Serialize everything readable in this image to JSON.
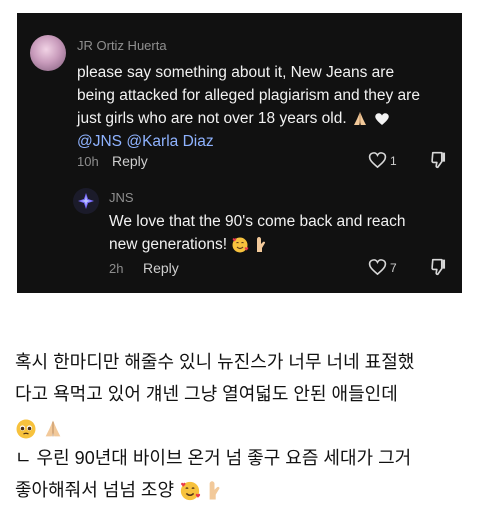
{
  "comment": {
    "username": "JR Ortiz Huerta",
    "line1": "please say something about it, New Jeans are",
    "line2": "being attacked for alleged plagiarism and they are",
    "line3": "just girls who are not over 18 years old.",
    "mention1": "@JNS",
    "mention2": "@Karla Diaz",
    "time": "10h",
    "reply_label": "Reply",
    "likes": "1",
    "icons": [
      "prayer-hands-emoji",
      "white-heart-emoji",
      "heart-outline-icon",
      "thumbs-down-icon"
    ]
  },
  "reply": {
    "username": "JNS",
    "line1": "We love that the 90's come back and reach",
    "line2": "new generations!",
    "time": "2h",
    "reply_label": "Reply",
    "likes": "7",
    "icons": [
      "smiling-face-with-hearts-emoji",
      "crossed-fingers-emoji",
      "heart-outline-icon",
      "thumbs-down-icon"
    ]
  },
  "caption": {
    "line1": "혹시 한마디만 해줄수 있니 뉴진스가 너무 너네 표절했",
    "line2": "다고 욕먹고 있어 걔넨 그냥 열여덟도 안된 애들인데",
    "line4": "ㄴ 우린 90년대 바이브 온거 넘 좋구 요즘 세대가 그거",
    "line5": "좋아해줘서 넘넘 조양",
    "icons": [
      "pleading-face-emoji",
      "prayer-hands-emoji",
      "smiling-face-with-hearts-emoji",
      "crossed-fingers-emoji"
    ]
  }
}
